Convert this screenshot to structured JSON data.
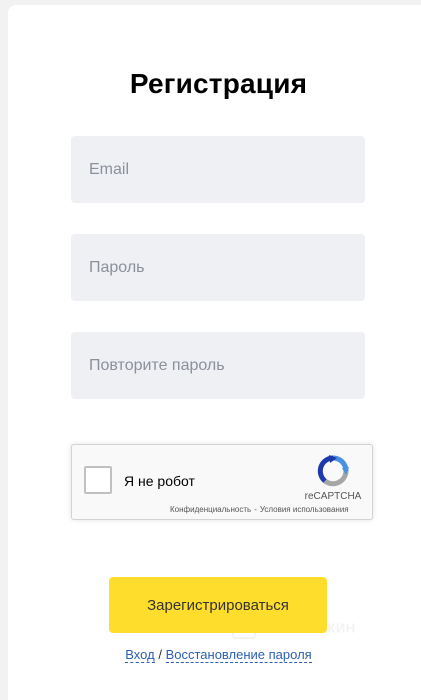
{
  "form": {
    "title": "Регистрация",
    "email_placeholder": "Email",
    "password_placeholder": "Пароль",
    "password_repeat_placeholder": "Повторите пароль",
    "submit_label": "Зарегистрироваться"
  },
  "captcha": {
    "label": "Я не робот",
    "brand": "reCAPTCHA",
    "privacy": "Конфиденциальность",
    "separator": "-",
    "terms": "Условия использования"
  },
  "links": {
    "login": "Вход",
    "separator": "/",
    "restore": "Восстановление пароля"
  },
  "watermark": {
    "text": "ПАРТНЁРКИН"
  },
  "colors": {
    "accent": "#ffdd2d",
    "field_bg": "#eef0f4",
    "link": "#2c5fb0"
  }
}
